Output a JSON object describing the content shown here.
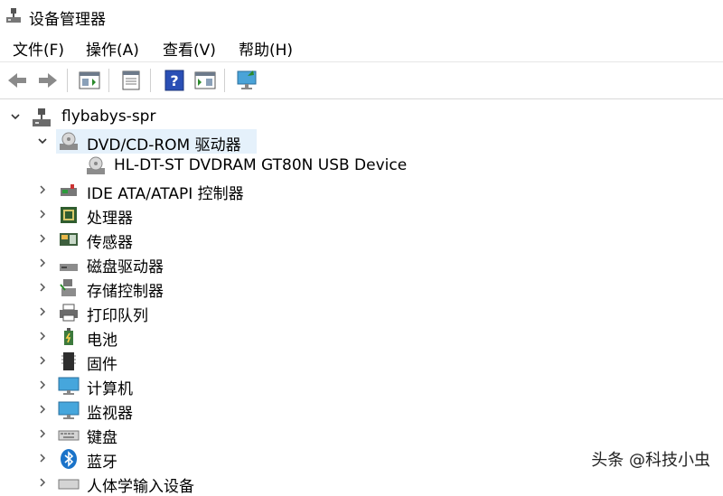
{
  "window": {
    "title": "设备管理器"
  },
  "menu": [
    {
      "label": "文件(F)"
    },
    {
      "label": "操作(A)"
    },
    {
      "label": "查看(V)"
    },
    {
      "label": "帮助(H)"
    }
  ],
  "toolbar": {
    "buttons": [
      {
        "name": "back-icon"
      },
      {
        "name": "forward-icon"
      },
      {
        "name": "show-hide-console-tree-icon"
      },
      {
        "name": "properties-icon"
      },
      {
        "name": "help-icon"
      },
      {
        "name": "action-pane-icon"
      },
      {
        "name": "scan-hardware-icon"
      }
    ]
  },
  "tree": {
    "root": {
      "label": "flybabys-spr",
      "expanded": true
    },
    "dvd": {
      "label": "DVD/CD-ROM 驱动器",
      "expanded": true,
      "selected": true,
      "child": "HL-DT-ST DVDRAM GT80N USB Device"
    },
    "categories": [
      {
        "label": "IDE ATA/ATAPI 控制器",
        "icon": "ide-controller-icon"
      },
      {
        "label": "处理器",
        "icon": "processor-icon"
      },
      {
        "label": "传感器",
        "icon": "sensor-icon"
      },
      {
        "label": "磁盘驱动器",
        "icon": "disk-drive-icon"
      },
      {
        "label": "存储控制器",
        "icon": "storage-controller-icon"
      },
      {
        "label": "打印队列",
        "icon": "printer-icon"
      },
      {
        "label": "电池",
        "icon": "battery-icon"
      },
      {
        "label": "固件",
        "icon": "firmware-icon"
      },
      {
        "label": "计算机",
        "icon": "computer-icon"
      },
      {
        "label": "监视器",
        "icon": "monitor-icon"
      },
      {
        "label": "键盘",
        "icon": "keyboard-icon"
      },
      {
        "label": "蓝牙",
        "icon": "bluetooth-icon"
      },
      {
        "label": "人体学输入设备",
        "icon": "hid-icon"
      }
    ]
  },
  "watermark": "头条 @科技小虫",
  "colors": {
    "selection": "#e5f1fb",
    "accent": "#1a73c9"
  }
}
